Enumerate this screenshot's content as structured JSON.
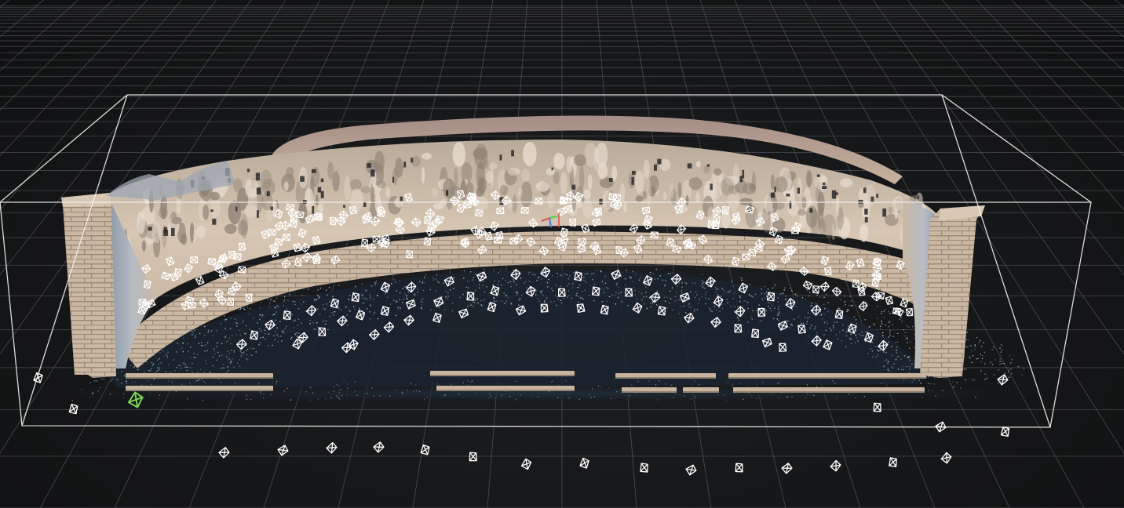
{
  "viewport": {
    "type": "3d-reconstruction-viewer",
    "colors": {
      "background": "#151617",
      "grid": "#6b6e73",
      "bounding_box": "#f2f2f2",
      "model": "#c7b39e",
      "model_shadow": "#8e8275",
      "model_highlight": "#e7dccf",
      "ground_points": "#a9c2d3",
      "camera": "#ffffff",
      "selected_camera": "#7ed957",
      "axis_x": "#e04b4b",
      "axis_y": "#4bd24b",
      "axis_z": "#4b7be0"
    },
    "icons": [
      "camera-frustum-icon",
      "selected-camera-icon",
      "gizmo-axis-icon"
    ]
  }
}
